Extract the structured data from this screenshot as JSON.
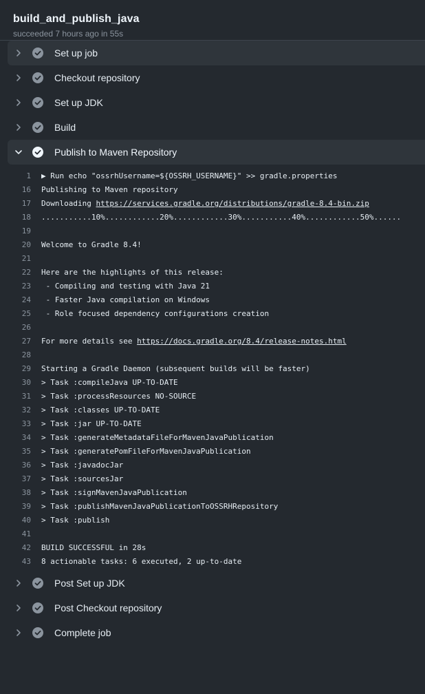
{
  "job": {
    "title": "build_and_publish_java",
    "status": "succeeded 7 hours ago in 55s"
  },
  "steps_before": [
    {
      "label": "Set up job"
    },
    {
      "label": "Checkout repository"
    },
    {
      "label": "Set up JDK"
    },
    {
      "label": "Build"
    }
  ],
  "open_step": {
    "label": "Publish to Maven Repository"
  },
  "log": [
    {
      "n": "1",
      "t": "▶ Run echo \"ossrhUsername=${OSSRH_USERNAME}\" >> gradle.properties"
    },
    {
      "n": "16",
      "t": "Publishing to Maven repository"
    },
    {
      "n": "17",
      "t": "Downloading ",
      "link": "https://services.gradle.org/distributions/gradle-8.4-bin.zip"
    },
    {
      "n": "18",
      "t": "...........10%............20%............30%...........40%............50%......"
    },
    {
      "n": "19",
      "t": ""
    },
    {
      "n": "20",
      "t": "Welcome to Gradle 8.4!"
    },
    {
      "n": "21",
      "t": ""
    },
    {
      "n": "22",
      "t": "Here are the highlights of this release:"
    },
    {
      "n": "23",
      "t": " - Compiling and testing with Java 21"
    },
    {
      "n": "24",
      "t": " - Faster Java compilation on Windows"
    },
    {
      "n": "25",
      "t": " - Role focused dependency configurations creation"
    },
    {
      "n": "26",
      "t": ""
    },
    {
      "n": "27",
      "t": "For more details see ",
      "link": "https://docs.gradle.org/8.4/release-notes.html"
    },
    {
      "n": "28",
      "t": ""
    },
    {
      "n": "29",
      "t": "Starting a Gradle Daemon (subsequent builds will be faster)"
    },
    {
      "n": "30",
      "t": "> Task :compileJava UP-TO-DATE"
    },
    {
      "n": "31",
      "t": "> Task :processResources NO-SOURCE"
    },
    {
      "n": "32",
      "t": "> Task :classes UP-TO-DATE"
    },
    {
      "n": "33",
      "t": "> Task :jar UP-TO-DATE"
    },
    {
      "n": "34",
      "t": "> Task :generateMetadataFileForMavenJavaPublication"
    },
    {
      "n": "35",
      "t": "> Task :generatePomFileForMavenJavaPublication"
    },
    {
      "n": "36",
      "t": "> Task :javadocJar"
    },
    {
      "n": "37",
      "t": "> Task :sourcesJar"
    },
    {
      "n": "38",
      "t": "> Task :signMavenJavaPublication"
    },
    {
      "n": "39",
      "t": "> Task :publishMavenJavaPublicationToOSSRHRepository"
    },
    {
      "n": "40",
      "t": "> Task :publish"
    },
    {
      "n": "41",
      "t": ""
    },
    {
      "n": "42",
      "t": "BUILD SUCCESSFUL in 28s"
    },
    {
      "n": "43",
      "t": "8 actionable tasks: 6 executed, 2 up-to-date"
    }
  ],
  "steps_after": [
    {
      "label": "Post Set up JDK"
    },
    {
      "label": "Post Checkout repository"
    },
    {
      "label": "Complete job"
    }
  ],
  "icons": {
    "status": "check-circle-icon",
    "collapsed": "chevron-right-icon",
    "expanded": "chevron-down-icon"
  },
  "colors": {
    "check_fill": "#8b949e",
    "background": "#24292f",
    "highlight": "#2f353b"
  }
}
